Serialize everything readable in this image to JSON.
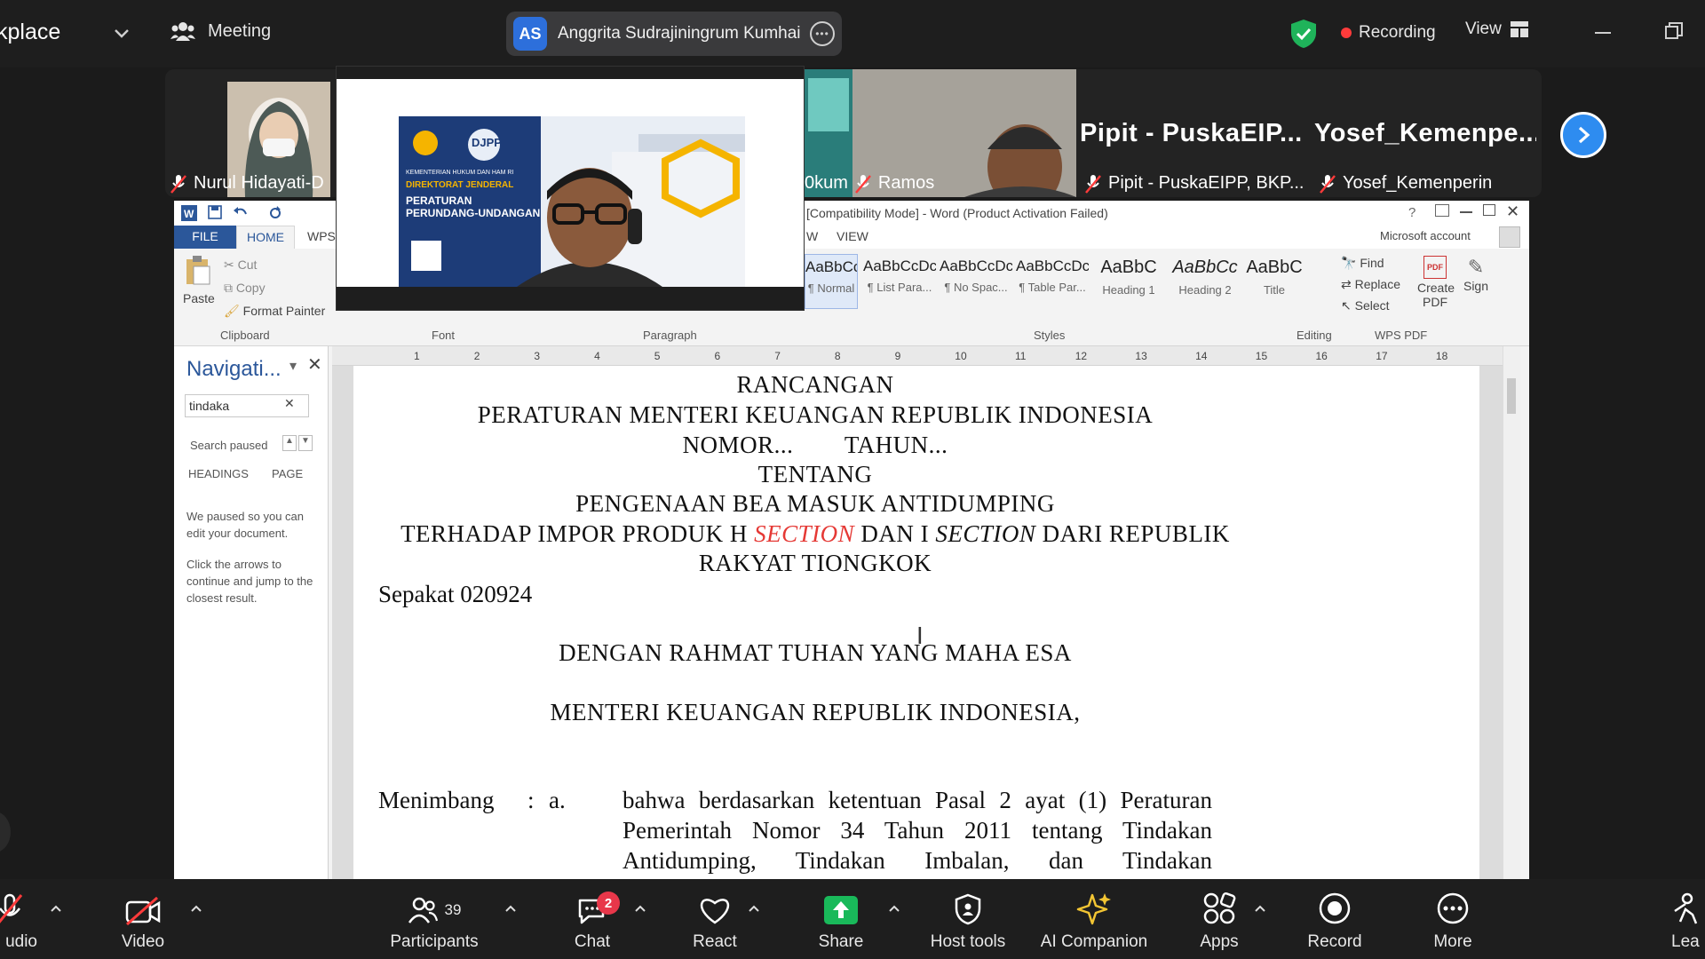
{
  "top_bar": {
    "app_title": "kplace",
    "meeting_label": "Meeting",
    "active_speaker": {
      "initials": "AS",
      "name": "Anggrita Sudrajiningrum Kumhai"
    },
    "recording_label": "Recording",
    "view_label": "View"
  },
  "participants": [
    {
      "name": "Nurul Hidayati-D"
    },
    {
      "name": "0kum"
    },
    {
      "name": "Ramos"
    },
    {
      "display_name": "Pipit - PuskaEIP...",
      "name": "Pipit - PuskaEIPP, BKP..."
    },
    {
      "display_name": "Yosef_Kemenpe...",
      "name": "Yosef_Kemenperin"
    }
  ],
  "word": {
    "title": "[Compatibility Mode] - Word (Product Activation Failed)",
    "tabs": {
      "file": "FILE",
      "home": "HOME",
      "wps": "WPS",
      "w": "W",
      "view": "VIEW"
    },
    "account": "Microsoft account",
    "clipboard": {
      "paste": "Paste",
      "cut": "Cut",
      "copy": "Copy",
      "format_painter": "Format Painter",
      "group": "Clipboard"
    },
    "groups": {
      "font": "Font",
      "paragraph": "Paragraph",
      "styles": "Styles",
      "editing": "Editing",
      "wps_pdf": "WPS PDF"
    },
    "styles": [
      {
        "sample": "AaBbCcDc",
        "name": "¶ Normal"
      },
      {
        "sample": "AaBbCcDc",
        "name": "¶ List Para..."
      },
      {
        "sample": "AaBbCcDc",
        "name": "¶ No Spac..."
      },
      {
        "sample": "AaBbCcDc",
        "name": "¶ Table Par..."
      },
      {
        "sample": "AaBbC",
        "name": "Heading 1"
      },
      {
        "sample": "AaBbCc",
        "name": "Heading 2"
      },
      {
        "sample": "AaBbC",
        "name": "Title"
      }
    ],
    "editing": {
      "find": "Find",
      "replace": "Replace",
      "select": "Select"
    },
    "pdf": {
      "create": "Create PDF",
      "sign": "Sign"
    },
    "ruler": [
      "1",
      "2",
      "3",
      "4",
      "5",
      "6",
      "7",
      "8",
      "9",
      "10",
      "11",
      "12",
      "13",
      "14",
      "15",
      "16",
      "17",
      "18"
    ],
    "nav": {
      "title": "Navigati...",
      "search_value": "tindaka",
      "status": "Search paused",
      "headings": "HEADINGS",
      "pages": "PAGE",
      "msg1": "We paused so you can edit your document.",
      "msg2": "Click the arrows to continue and jump to the closest result."
    },
    "doc": {
      "l1": "RANCANGAN",
      "l2": "PERATURAN MENTERI KEUANGAN REPUBLIK INDONESIA",
      "l3": "NOMOR...        TAHUN...",
      "l4": "TENTANG",
      "l5": "PENGENAAN BEA MASUK ANTIDUMPING",
      "l6a": "TERHADAP IMPOR PRODUK H ",
      "l6b": "SECTION",
      "l6c": " DAN I ",
      "l6d": "SECTION",
      "l6e": " DARI REPUBLIK",
      "l7": "RAKYAT TIONGKOK",
      "sepakat": "Sepakat 020924",
      "rahmat": "DENGAN RAHMAT TUHAN YANG MAHA ESA",
      "menteri": "MENTERI KEUANGAN REPUBLIK INDONESIA,",
      "menimbang": "Menimbang",
      "colon": ":",
      "a": "a.",
      "a_line1": "bahwa berdasarkan ketentuan Pasal 2 ayat (1) Peraturan",
      "a_line2": "Pemerintah Nomor 34 Tahun 2011 tentang Tindakan",
      "a_line3": "Antidumping, Tindakan Imbalan, dan Tindakan"
    }
  },
  "share_thumb": {
    "header": "DJPP",
    "line1": "KEMENTERIAN HUKUM DAN HAM RI",
    "line2": "DIREKTORAT JENDERAL",
    "line3": "PERATURAN",
    "line4": "PERUNDANG-UNDANGAN"
  },
  "toolbar": {
    "audio": "udio",
    "video": "Video",
    "participants": "Participants",
    "participants_count": "39",
    "chat": "Chat",
    "chat_badge": "2",
    "react": "React",
    "share": "Share",
    "host_tools": "Host tools",
    "ai_companion": "AI Companion",
    "apps": "Apps",
    "record": "Record",
    "more": "More",
    "leave": "Lea"
  },
  "colors": {
    "accent": "#2e8cf0",
    "share_green": "#19b95a",
    "record_red": "#ff3b3b",
    "word_blue": "#2b579a"
  }
}
